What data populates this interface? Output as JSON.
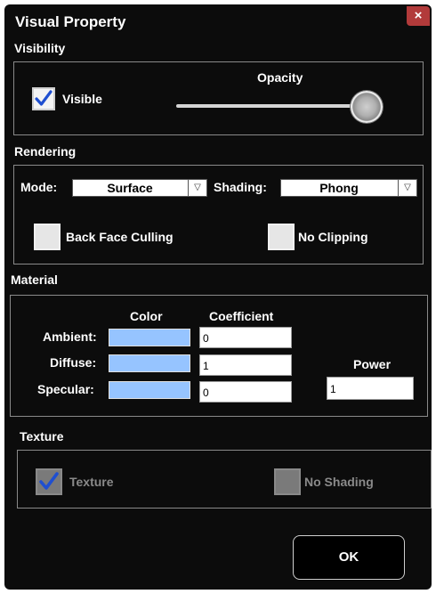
{
  "dialog": {
    "title": "Visual Property",
    "close_glyph": "×"
  },
  "visibility": {
    "section_label": "Visibility",
    "visible_label": "Visible",
    "visible_checked": true,
    "opacity_label": "Opacity",
    "opacity_value": 1.0
  },
  "rendering": {
    "section_label": "Rendering",
    "mode_label": "Mode:",
    "mode_value": "Surface",
    "shading_label": "Shading:",
    "shading_value": "Phong",
    "dropdown_arrow": "▽",
    "back_face_culling_label": "Back Face Culling",
    "back_face_culling_checked": false,
    "no_clipping_label": "No Clipping",
    "no_clipping_checked": false
  },
  "material": {
    "section_label": "Material",
    "color_header": "Color",
    "coefficient_header": "Coefficient",
    "power_label": "Power",
    "power_value": "1",
    "rows": [
      {
        "label": "Ambient:",
        "coefficient": "0",
        "color": "#96c4ff"
      },
      {
        "label": "Diffuse:",
        "coefficient": "1",
        "color": "#96c4ff"
      },
      {
        "label": "Specular:",
        "coefficient": "0",
        "color": "#96c4ff"
      }
    ]
  },
  "texture": {
    "section_label": "Texture",
    "texture_label": "Texture",
    "texture_checked": true,
    "no_shading_label": "No Shading",
    "no_shading_checked": false,
    "disabled": true
  },
  "footer": {
    "ok_label": "OK"
  },
  "colors": {
    "background": "#0c0c0c",
    "close_button": "#b23a3a",
    "check_blue": "#1f4fd0",
    "swatch": "#96c4ff"
  }
}
